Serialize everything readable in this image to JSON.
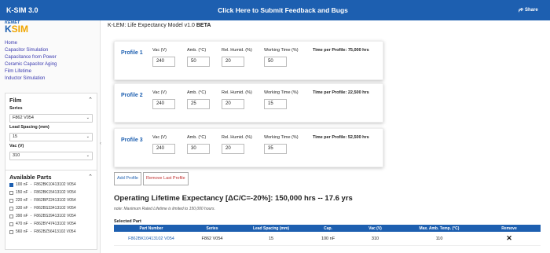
{
  "topbar": {
    "brand": "K-SIM 3.0",
    "banner": "Click Here to Submit Feedback and Bugs",
    "share": "Share"
  },
  "logo": {
    "kemet": "KEMET",
    "k": "K",
    "sim": "SIM"
  },
  "nav": [
    "Home",
    "Capacitor Simulation",
    "Capacitance from Power",
    "Ceramic Capacitor Aging",
    "Film Lifetime",
    "Inductor Simulation"
  ],
  "film": {
    "title": "Film",
    "series_label": "Series",
    "series_value": "F862 V054",
    "lead_label": "Lead Spacing (mm)",
    "lead_value": "15",
    "vac_label": "Vac (V)",
    "vac_value": "310"
  },
  "parts": {
    "title": "Available Parts",
    "items": [
      {
        "cap": "100 nF",
        "pn": "F862BK10413102 V054",
        "checked": true
      },
      {
        "cap": "150 nF",
        "pn": "F862BK15413102 V054",
        "checked": false
      },
      {
        "cap": "220 nF",
        "pn": "F862BP22413102 V054",
        "checked": false
      },
      {
        "cap": "330 nF",
        "pn": "F862BS33413102 V054",
        "checked": false
      },
      {
        "cap": "390 nF",
        "pn": "F862BS39413102 V054",
        "checked": false
      },
      {
        "cap": "470 nF",
        "pn": "F862BY47413102 V054",
        "checked": false
      },
      {
        "cap": "560 nF",
        "pn": "F862BZ56413102 V054",
        "checked": false
      }
    ]
  },
  "main": {
    "title_prefix": "K-LEM: Life Expectancy Model v1.0 ",
    "title_beta": "BETA",
    "labels": {
      "vac": "Vac (V)",
      "amb": "Amb. (°C)",
      "humid": "Rel. Humid. (%)",
      "work": "Working Time (%)"
    },
    "profiles": [
      {
        "name": "Profile 1",
        "vac": "240",
        "amb": "50",
        "humid": "20",
        "work": "50",
        "time": "Time per Profile: 75,000 hrs"
      },
      {
        "name": "Profile 2",
        "vac": "240",
        "amb": "25",
        "humid": "20",
        "work": "15",
        "time": "Time per Profile: 22,500 hrs"
      },
      {
        "name": "Profile 3",
        "vac": "240",
        "amb": "30",
        "humid": "20",
        "work": "35",
        "time": "Time per Profile: 52,500 hrs"
      }
    ],
    "add_profile": "Add Profile",
    "remove_profile": "Remove Last Profile",
    "lifetime_title": "Operating Lifetime Expectancy [ΔC/C=-20%]: 150,000 hrs -- 17.6 yrs",
    "lifetime_note": "note: Maximum Rated Lifetime is limited to 150,000 hours.",
    "selected_title": "Selected Part",
    "table": {
      "headers": [
        "Part Number",
        "Series",
        "Lead Spacing (mm)",
        "Cap.",
        "Vac (V)",
        "Max. Amb. Temp. (°C)",
        "Remove"
      ],
      "row": [
        "F862BK10413102 V054",
        "F862 V054",
        "15",
        "100 nF",
        "310",
        "110"
      ]
    }
  },
  "colors": {
    "accent": "#1d5fb0",
    "logo_orange": "#f0a500",
    "remove": "#c03030"
  }
}
